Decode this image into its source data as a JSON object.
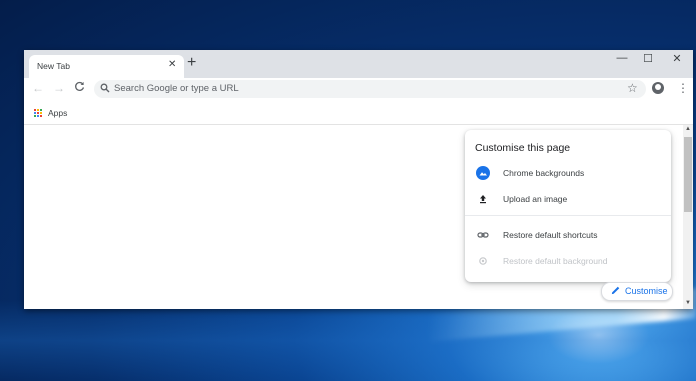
{
  "browser": {
    "tab": {
      "title": "New Tab",
      "close_glyph": "✕"
    },
    "new_tab_glyph": "+",
    "window_controls": {
      "minimize": "—",
      "maximize": "☐",
      "close": "✕"
    },
    "toolbar": {
      "back_glyph": "←",
      "forward_glyph": "→",
      "reload_glyph": "C",
      "omnibox_placeholder": "Search Google or type a URL",
      "star_glyph": "☆",
      "menu_glyph": "⋮"
    },
    "bookmarks_bar": {
      "apps_label": "Apps"
    }
  },
  "customise_panel": {
    "title": "Customise this page",
    "items": [
      {
        "label": "Chrome backgrounds",
        "icon": "chrome-backgrounds-icon",
        "enabled": true
      },
      {
        "label": "Upload an image",
        "icon": "upload-icon",
        "enabled": true
      },
      {
        "label": "Restore default shortcuts",
        "icon": "link-icon",
        "enabled": true
      },
      {
        "label": "Restore default background",
        "icon": "restore-background-icon",
        "enabled": false
      }
    ]
  },
  "customise_button": {
    "label": "Customise",
    "icon": "pencil-icon"
  },
  "colors": {
    "accent": "#1a73e8",
    "titlebar": "#dee1e6",
    "omnibox": "#f1f3f4",
    "apps_grid": [
      "#ea4335",
      "#fbbc05",
      "#34a853",
      "#4285f4"
    ]
  }
}
